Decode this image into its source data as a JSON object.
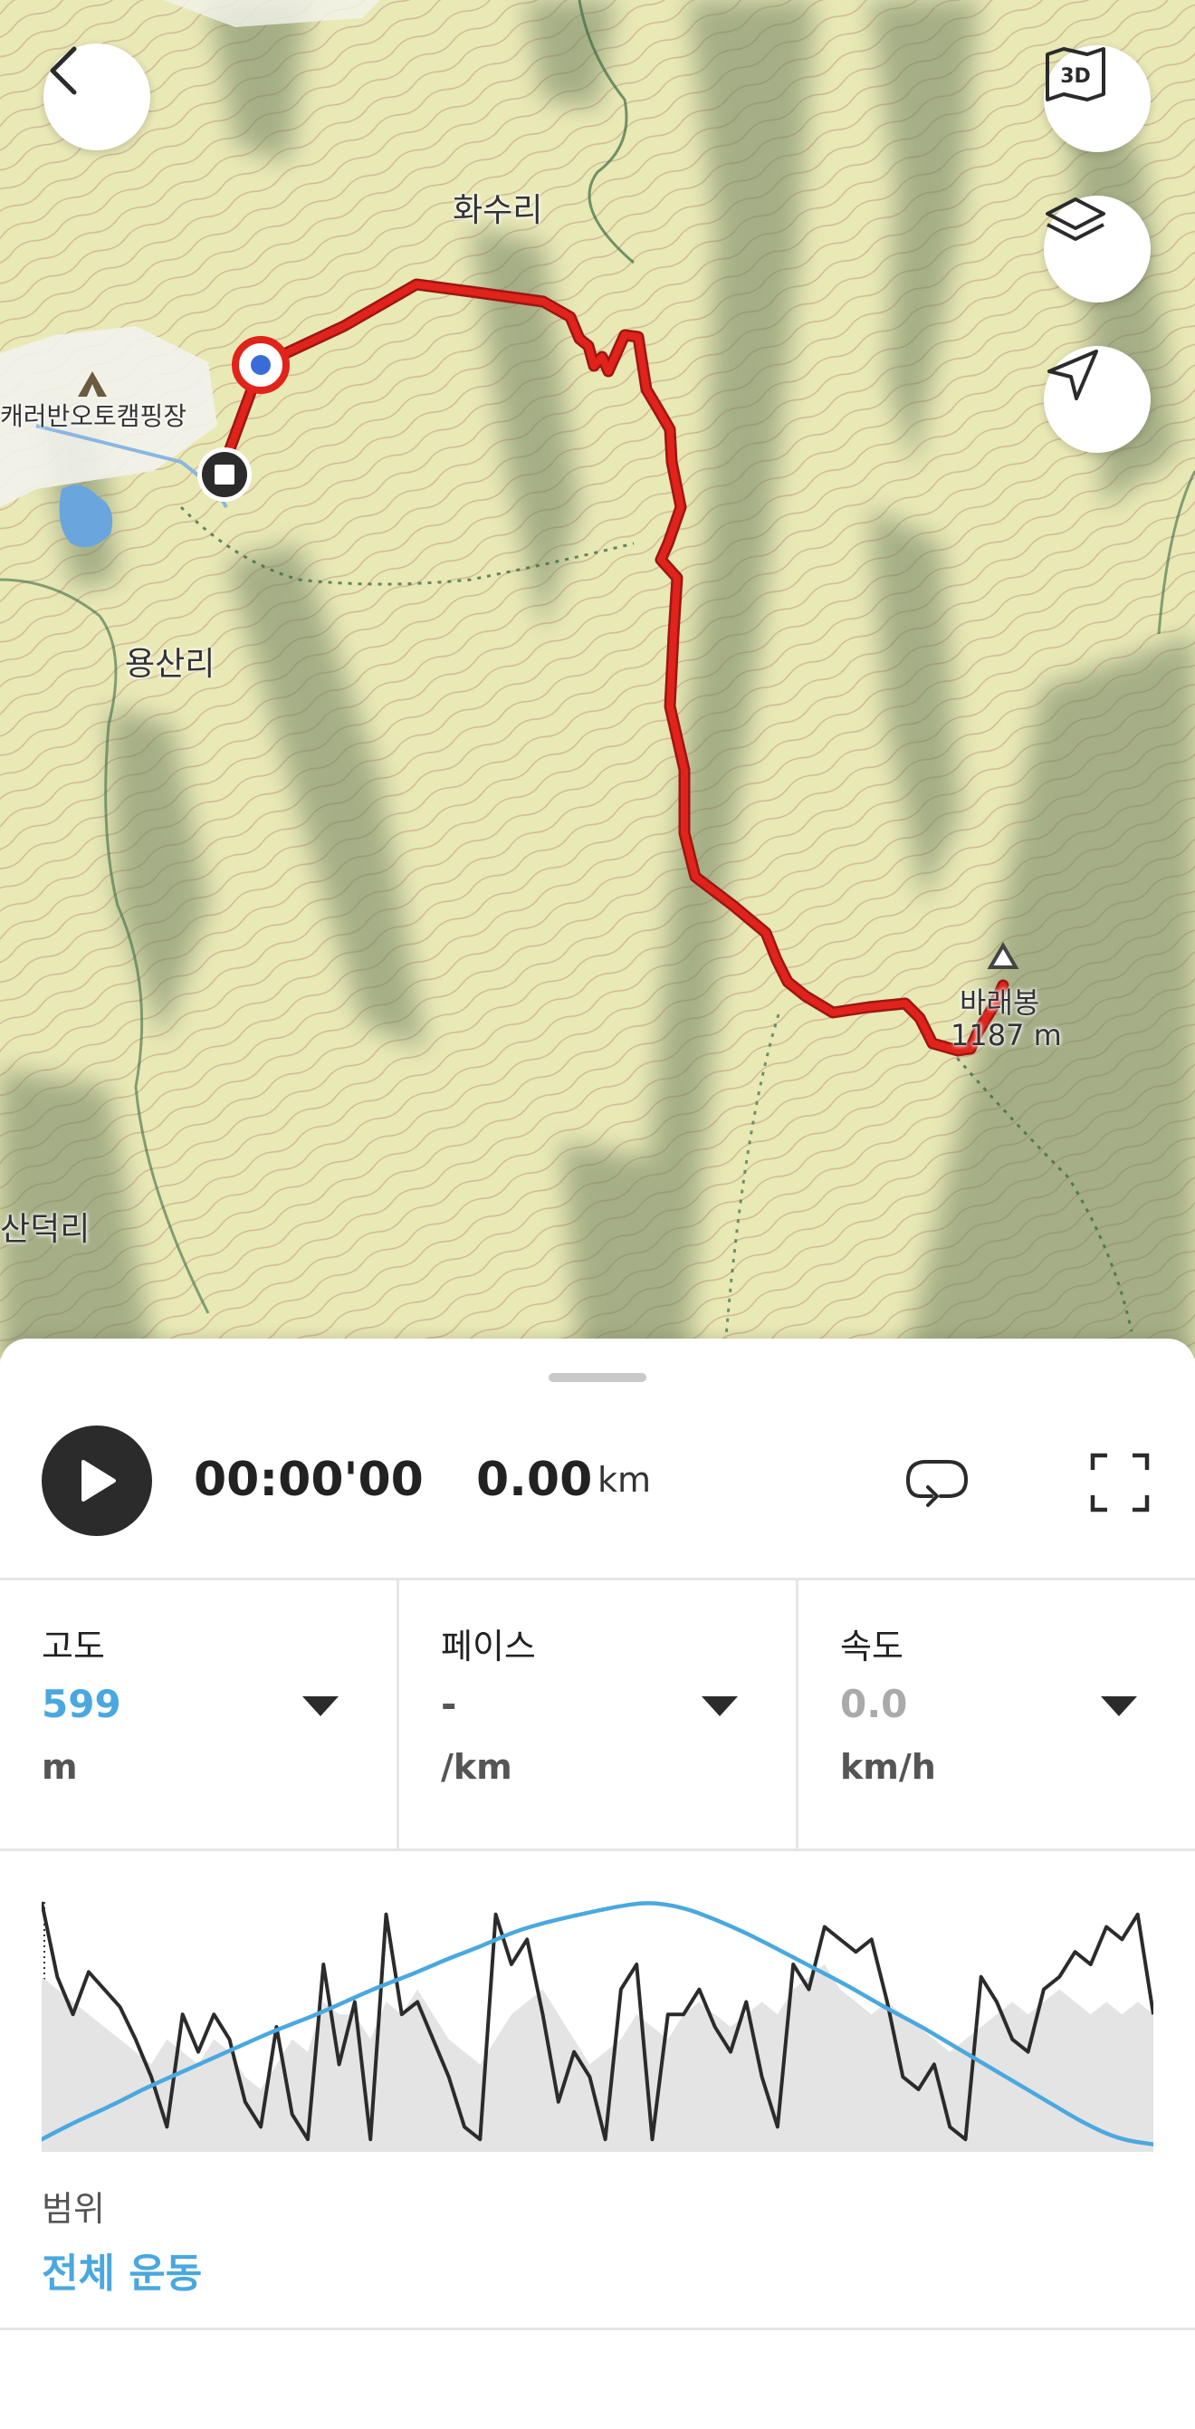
{
  "map": {
    "labels": {
      "hwasuri": "화수리",
      "campsite": "캐러반오토캠핑장",
      "yongsanri": "용산리",
      "sandeokri": "산덕리",
      "peak_name": "바래봉",
      "peak_elevation": "1187 m"
    },
    "buttons": {
      "back": "back",
      "view_3d": "3D",
      "layers": "layers",
      "locate": "locate"
    },
    "colors": {
      "route": "#e0231b",
      "start_marker": "#3a6cd9",
      "end_marker": "#2b2b2b"
    }
  },
  "player": {
    "time": "00:00'00",
    "distance_value": "0.00",
    "distance_unit": "km"
  },
  "metrics": [
    {
      "label": "고도",
      "value": "599",
      "unit": "m",
      "value_color": "#4aa8de"
    },
    {
      "label": "페이스",
      "value": "-",
      "unit": "/km",
      "value_color": "#555555"
    },
    {
      "label": "속도",
      "value": "0.0",
      "unit": "km/h",
      "value_color": "#aaaaaa"
    }
  ],
  "chart_data": {
    "type": "line",
    "series": [
      {
        "color": "#4aa8de",
        "style": "altitude",
        "values": [
          0.05,
          0.12,
          0.18,
          0.25,
          0.31,
          0.37,
          0.43,
          0.49,
          0.54,
          0.6,
          0.66,
          0.71,
          0.77,
          0.82,
          0.88,
          0.92,
          0.95,
          0.98,
          1.0,
          0.98,
          0.93,
          0.87,
          0.8,
          0.73,
          0.66,
          0.58,
          0.51,
          0.43,
          0.35,
          0.27,
          0.19,
          0.11,
          0.05,
          0.03
        ]
      },
      {
        "color": "#2b2b2b",
        "style": "speed",
        "values": [
          1.0,
          0.7,
          0.55,
          0.72,
          0.65,
          0.58,
          0.45,
          0.3,
          0.1,
          0.55,
          0.4,
          0.55,
          0.45,
          0.2,
          0.1,
          0.5,
          0.15,
          0.05,
          0.75,
          0.35,
          0.6,
          0.05,
          0.95,
          0.55,
          0.6,
          0.45,
          0.3,
          0.1,
          0.05,
          0.95,
          0.75,
          0.85,
          0.55,
          0.2,
          0.4,
          0.3,
          0.05,
          0.65,
          0.75,
          0.05,
          0.55,
          0.55,
          0.65,
          0.5,
          0.4,
          0.6,
          0.3,
          0.1,
          0.75,
          0.65,
          0.9,
          0.85,
          0.8,
          0.85,
          0.6,
          0.3,
          0.25,
          0.35,
          0.1,
          0.05,
          0.7,
          0.6,
          0.45,
          0.4,
          0.65,
          0.7,
          0.8,
          0.75,
          0.9,
          0.85,
          0.95,
          0.55
        ]
      },
      {
        "color": "#e4e4e4",
        "style": "fill",
        "values": [
          0.7,
          0.65,
          0.6,
          0.55,
          0.5,
          0.45,
          0.4,
          0.35,
          0.45,
          0.4,
          0.35,
          0.45,
          0.4,
          0.3,
          0.25,
          0.35,
          0.45,
          0.4,
          0.6,
          0.55,
          0.55,
          0.45,
          0.6,
          0.55,
          0.65,
          0.55,
          0.45,
          0.4,
          0.35,
          0.45,
          0.55,
          0.6,
          0.65,
          0.55,
          0.45,
          0.35,
          0.4,
          0.45,
          0.55,
          0.5,
          0.45,
          0.55,
          0.6,
          0.55,
          0.5,
          0.55,
          0.6,
          0.55,
          0.65,
          0.7,
          0.75,
          0.65,
          0.6,
          0.55,
          0.6,
          0.55,
          0.5,
          0.45,
          0.4,
          0.45,
          0.5,
          0.55,
          0.6,
          0.55,
          0.6,
          0.65,
          0.6,
          0.55,
          0.6,
          0.55,
          0.6,
          0.55
        ]
      }
    ]
  },
  "range": {
    "label": "범위",
    "value": "전체 운동"
  }
}
